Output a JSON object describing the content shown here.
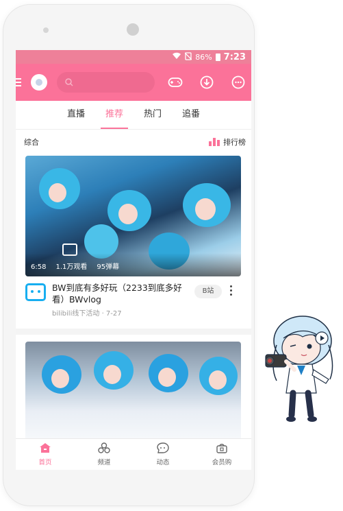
{
  "status_bar": {
    "battery": "86%",
    "time": "7:23"
  },
  "header": {
    "search_placeholder": ""
  },
  "tabs": [
    {
      "label": "直播",
      "active": false
    },
    {
      "label": "推荐",
      "active": true
    },
    {
      "label": "热门",
      "active": false
    },
    {
      "label": "追番",
      "active": false
    }
  ],
  "section": {
    "title": "综合",
    "ranking_label": "排行榜"
  },
  "cards": [
    {
      "duration": "6:58",
      "views": "1.1万观看",
      "danmaku": "95弹幕",
      "title": "BW到底有多好玩（2233到底多好看）BWvlog",
      "uploader": "bilibili线下活动",
      "date": "· 7-27",
      "tag": "B站"
    }
  ],
  "bottom_nav": [
    {
      "label": "首页",
      "icon": "home-icon",
      "active": true
    },
    {
      "label": "频道",
      "icon": "channel-icon",
      "active": false
    },
    {
      "label": "动态",
      "icon": "dynamic-icon",
      "active": false
    },
    {
      "label": "会员购",
      "icon": "shop-icon",
      "active": false
    }
  ],
  "colors": {
    "brand_pink": "#fb7299",
    "status_pink": "#ee8099",
    "uploader_blue": "#17aef0"
  }
}
